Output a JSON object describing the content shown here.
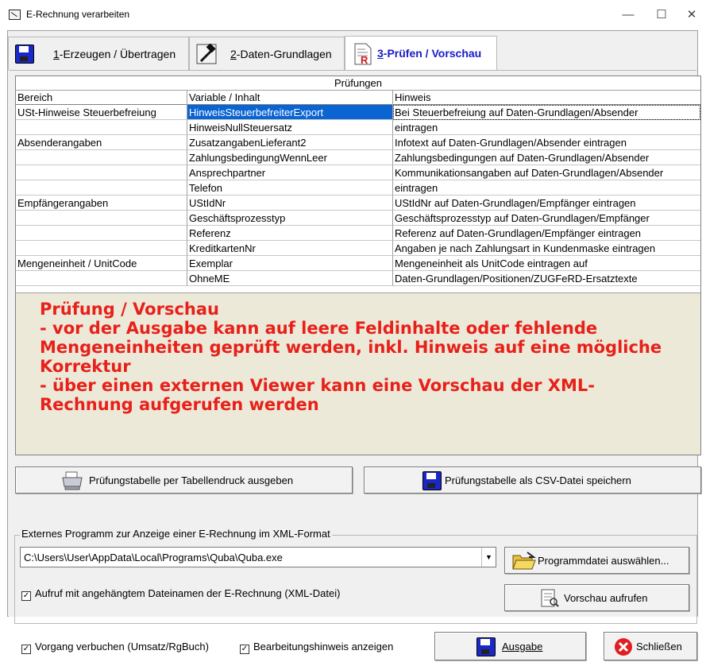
{
  "window": {
    "title": "E-Rechnung verarbeiten",
    "minimize": "—",
    "maximize": "☐",
    "close": "✕"
  },
  "tabs": [
    {
      "num": "1",
      "label": "-Erzeugen / Übertragen",
      "icon": "floppy-disk-icon",
      "active": false
    },
    {
      "num": "2",
      "label": "-Daten-Grundlagen",
      "icon": "hammer-icon",
      "active": false
    },
    {
      "num": "3",
      "label": "-Prüfen / Vorschau",
      "icon": "document-red-r-icon",
      "active": true
    }
  ],
  "grid": {
    "caption": "Prüfungen",
    "columns": [
      "Bereich",
      "Variable / Inhalt",
      "Hinweis"
    ],
    "rows": [
      {
        "bereich": "USt-Hinweise Steuerbefreiung",
        "variable": "HinweisSteuerbefreiterExport",
        "hinweis": "Bei Steuerbefreiung auf Daten-Grundlagen/Absender"
      },
      {
        "bereich": "",
        "variable": "HinweisNullSteuersatz",
        "hinweis": "eintragen"
      },
      {
        "bereich": "Absenderangaben",
        "variable": "ZusatzangabenLieferant2",
        "hinweis": "Infotext auf Daten-Grundlagen/Absender eintragen"
      },
      {
        "bereich": "",
        "variable": "ZahlungsbedingungWennLeer",
        "hinweis": "Zahlungsbedingungen auf Daten-Grundlagen/Absender"
      },
      {
        "bereich": "",
        "variable": "Ansprechpartner",
        "hinweis": "Kommunikationsangaben auf Daten-Grundlagen/Absender"
      },
      {
        "bereich": "",
        "variable": "Telefon",
        "hinweis": "eintragen"
      },
      {
        "bereich": "Empfängerangaben",
        "variable": "UStIdNr",
        "hinweis": "UStIdNr auf Daten-Grundlagen/Empfänger eintragen"
      },
      {
        "bereich": "",
        "variable": "Geschäftsprozesstyp",
        "hinweis": "Geschäftsprozesstyp auf Daten-Grundlagen/Empfänger"
      },
      {
        "bereich": "",
        "variable": "Referenz",
        "hinweis": "Referenz auf Daten-Grundlagen/Empfänger eintragen"
      },
      {
        "bereich": "",
        "variable": "KreditkartenNr",
        "hinweis": "Angaben je nach Zahlungsart in Kundenmaske eintragen"
      },
      {
        "bereich": "Mengeneinheit / UnitCode",
        "variable": "Exemplar",
        "hinweis": "Mengeneinheit als UnitCode eintragen auf"
      },
      {
        "bereich": "",
        "variable": "OhneME",
        "hinweis": "Daten-Grundlagen/Positionen/ZUGFeRD-Ersatztexte"
      }
    ],
    "selected_row": 0
  },
  "note": "Prüfung / Vorschau\n- vor der Ausgabe kann auf leere Feldinhalte oder fehlende Mengeneinheiten geprüft werden, inkl. Hinweis auf eine mögliche Korrektur\n- über einen externen Viewer kann eine Vorschau der XML-Rechnung aufgerufen werden",
  "note_color": "#e8201a",
  "buttons": {
    "print_table": "Prüfungstabelle per Tabellendruck ausgeben",
    "save_csv": "Prüfungstabelle als CSV-Datei speichern",
    "choose_program": "Programmdatei auswählen...",
    "preview": "Vorschau aufrufen",
    "ausgabe": "Ausgabe",
    "schliessen": "Schließen"
  },
  "viewer_group": {
    "legend": "Externes Programm zur Anzeige einer E-Rechnung im XML-Format",
    "program_path": "C:\\Users\\User\\AppData\\Local\\Programs\\Quba\\Quba.exe",
    "attach_filename_label": "Aufruf mit angehängtem Dateinamen der E-Rechnung (XML-Datei)",
    "attach_filename_checked": true
  },
  "footer": {
    "book_label": "Vorgang verbuchen (Umsatz/RgBuch)",
    "book_checked": true,
    "hint_label": "Bearbeitungshinweis anzeigen",
    "hint_checked": true
  },
  "colors": {
    "selection": "#0a64d2",
    "active_tab_text": "#1a1ac8",
    "note_background": "#ece9d8"
  }
}
